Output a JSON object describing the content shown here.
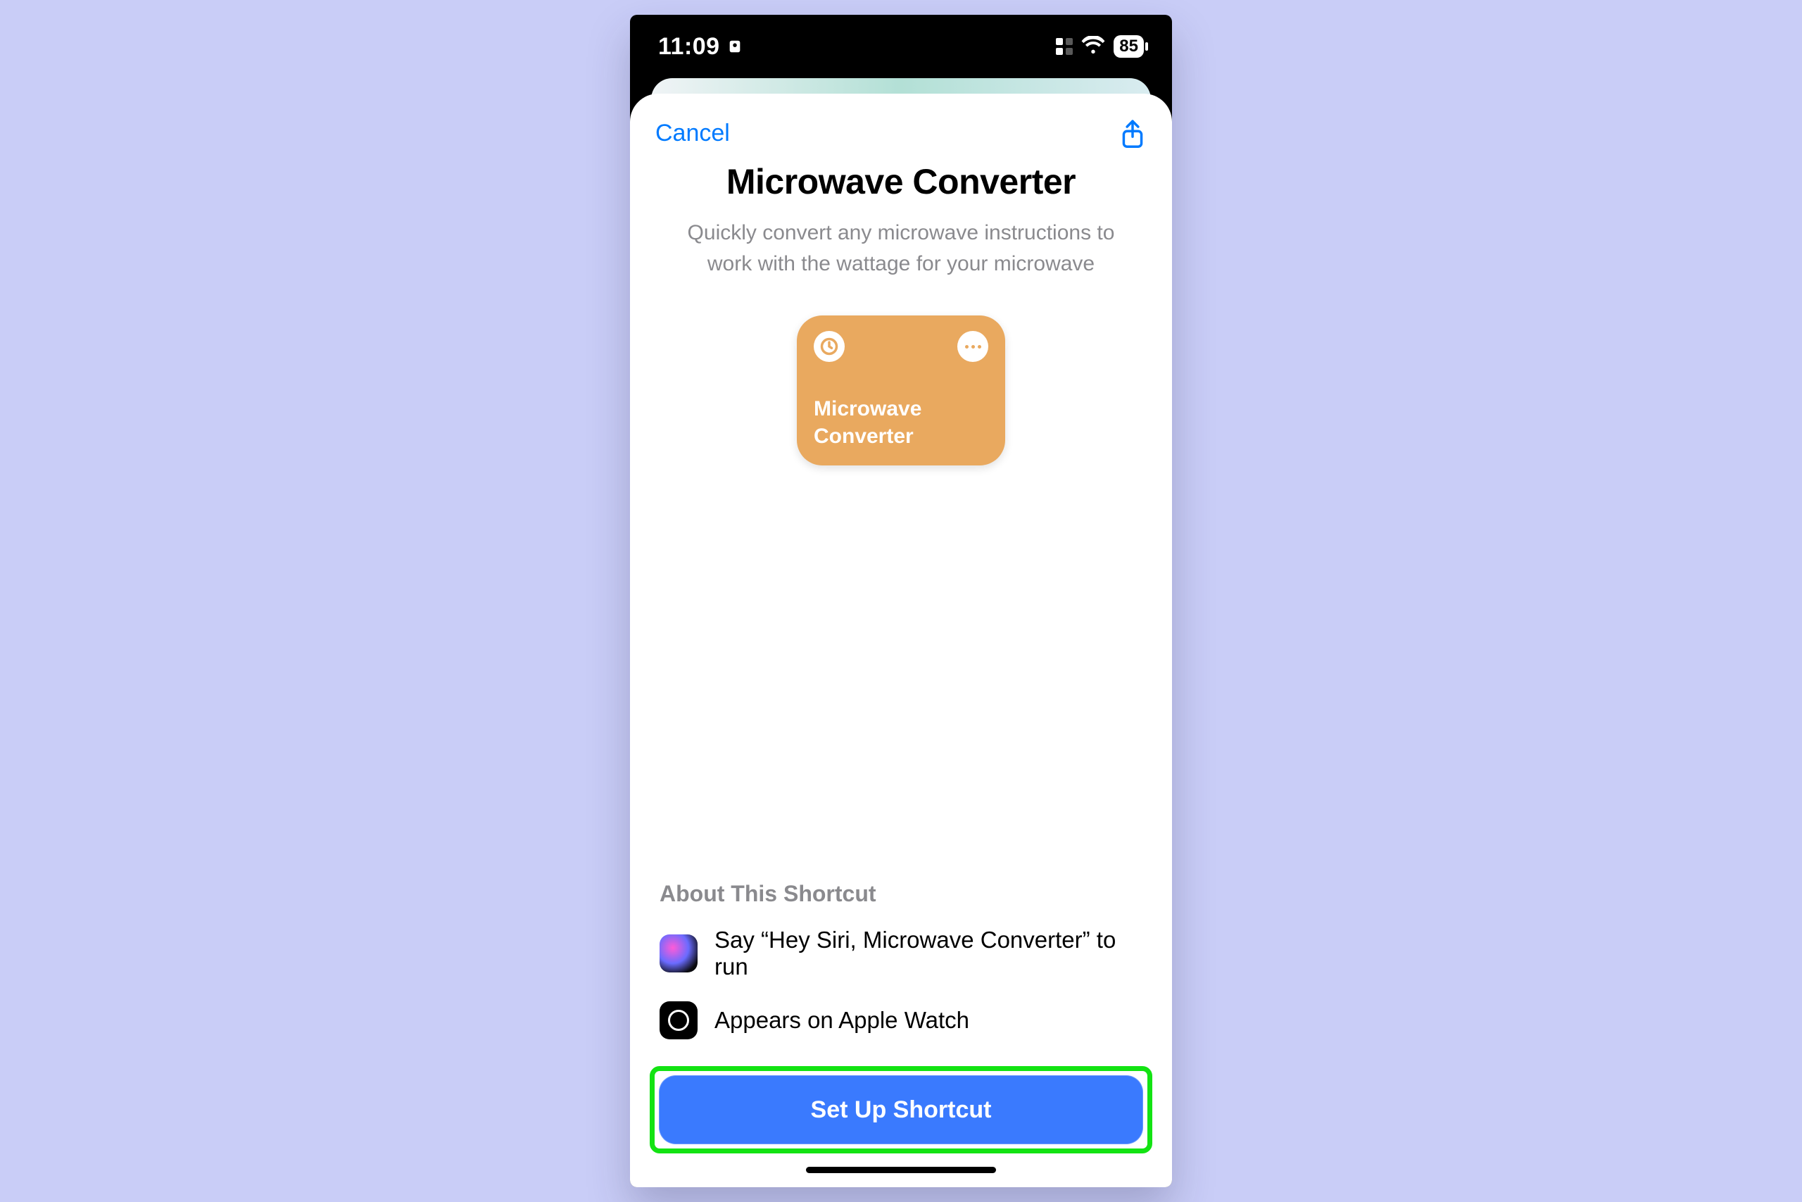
{
  "status_bar": {
    "time": "11:09",
    "battery_percent": "85"
  },
  "sheet": {
    "cancel_label": "Cancel",
    "title": "Microwave Converter",
    "subtitle": "Quickly convert any microwave instructions to work with the wattage for your microwave"
  },
  "shortcut_card": {
    "name": "Microwave Converter"
  },
  "about": {
    "heading": "About This Shortcut",
    "siri_line": "Say “Hey Siri, Microwave Converter” to run",
    "watch_line": "Appears on Apple Watch"
  },
  "primary_button": {
    "label": "Set Up Shortcut"
  },
  "colors": {
    "ios_blue": "#007aff",
    "card_orange": "#e9a95f",
    "highlight_green": "#13e313",
    "button_blue": "#3a7afe"
  }
}
